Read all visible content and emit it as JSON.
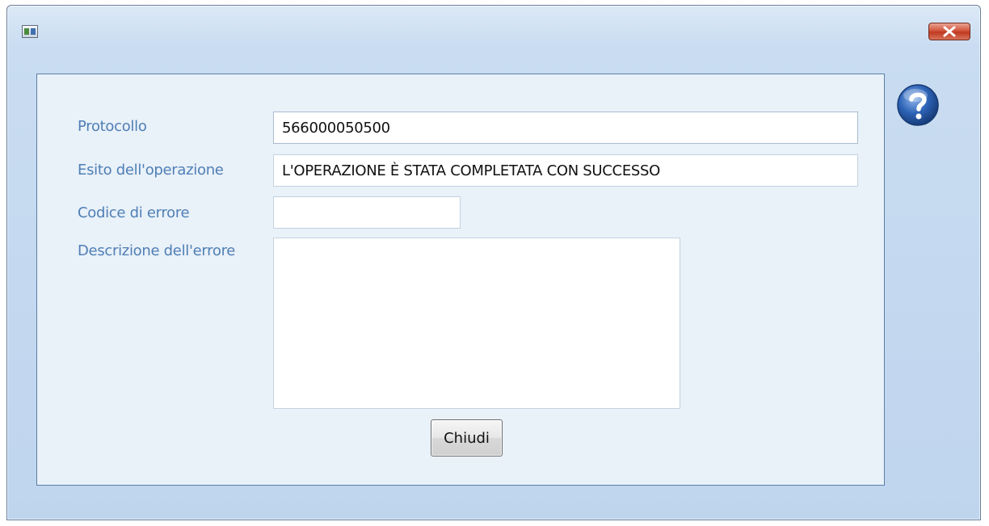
{
  "window": {
    "title": ""
  },
  "form": {
    "protocol_label": "Protocollo",
    "protocol_value": "566000050500",
    "outcome_label": "Esito dell'operazione",
    "outcome_value": "L'OPERAZIONE È STATA COMPLETATA CON SUCCESSO",
    "error_code_label": "Codice di errore",
    "error_code_value": "",
    "error_description_label": "Descrizione dell'errore",
    "error_description_value": ""
  },
  "actions": {
    "close_label": "Chiudi"
  },
  "icons": {
    "app": "app-icon",
    "close": "close-icon",
    "help": "help-icon"
  },
  "colors": {
    "label": "#4f7fb5",
    "close_button": "#c9472e",
    "help": "#2a5ba8"
  }
}
